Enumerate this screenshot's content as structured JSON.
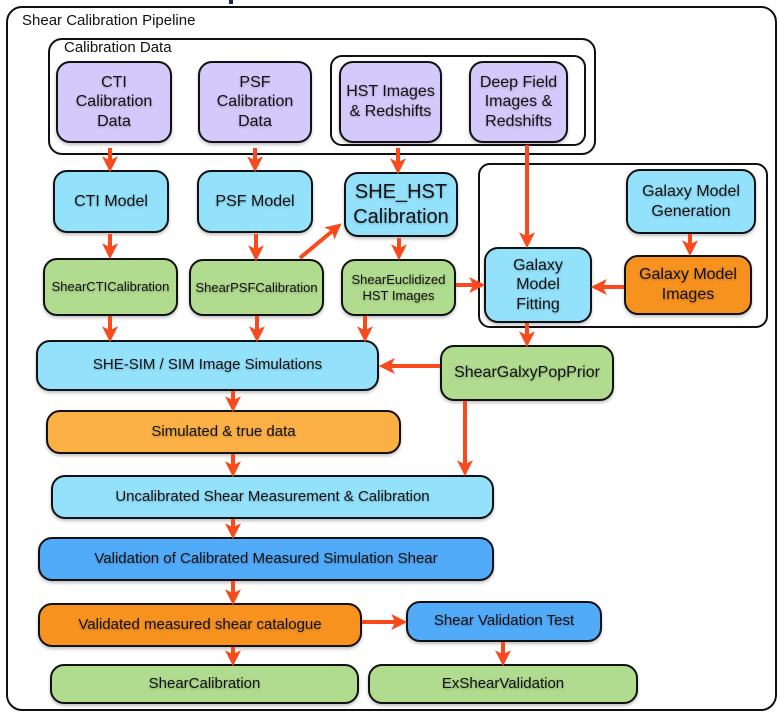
{
  "diagram": {
    "title": "Shear Calibration Pipeline",
    "colors": {
      "arrow": "#f84a1c",
      "input_data": "#d3c9fb",
      "process": "#93e1fb",
      "product": "#b1db8e",
      "data_light_orange": "#fbb045",
      "data_dark_orange": "#f7921f",
      "validation": "#52abf9",
      "border": "#111111"
    },
    "groups": {
      "calibration_data": {
        "label": "Calibration Data"
      }
    },
    "nodes": {
      "cti_calibration_data": "CTI\nCalibration\nData",
      "psf_calibration_data": "PSF\nCalibration\nData",
      "hst_images_redshifts": "HST Images\n& Redshifts",
      "deep_field_images_redshifts": "Deep Field\nImages &\nRedshifts",
      "cti_model": "CTI Model",
      "psf_model": "PSF Model",
      "she_hst_calibration": "SHE_HST\nCalibration",
      "galaxy_model_generation": "Galaxy Model\nGeneration",
      "shear_cti_calibration": "ShearCTICalibration",
      "shear_psf_calibration": "ShearPSFCalibration",
      "shear_euclidized_hst_images": "ShearEuclidized\nHST Images",
      "galaxy_model_fitting": "Galaxy\nModel\nFitting",
      "galaxy_model_images": "Galaxy Model\nImages",
      "she_sim_image_simulations": "SHE-SIM / SIM Image Simulations",
      "shear_galaxy_pop_prior": "ShearGalxyPopPrior",
      "simulated_true_data": "Simulated & true data",
      "uncalibrated_shear_measurement": "Uncalibrated Shear Measurement & Calibration",
      "validation_calibrated_measured": "Validation of Calibrated Measured Simulation Shear",
      "validated_measured_shear_catalogue": "Validated measured shear catalogue",
      "shear_validation_test": "Shear Validation Test",
      "shear_calibration": "ShearCalibration",
      "ex_shear_validation": "ExShearValidation"
    },
    "edges": [
      [
        "cti_calibration_data",
        "cti_model"
      ],
      [
        "psf_calibration_data",
        "psf_model"
      ],
      [
        "hst_images_redshifts",
        "she_hst_calibration"
      ],
      [
        "deep_field_images_redshifts",
        "galaxy_model_fitting"
      ],
      [
        "cti_model",
        "shear_cti_calibration"
      ],
      [
        "psf_model",
        "shear_psf_calibration"
      ],
      [
        "shear_psf_calibration",
        "she_hst_calibration"
      ],
      [
        "she_hst_calibration",
        "shear_euclidized_hst_images"
      ],
      [
        "shear_euclidized_hst_images",
        "galaxy_model_fitting"
      ],
      [
        "galaxy_model_generation",
        "galaxy_model_images"
      ],
      [
        "galaxy_model_images",
        "galaxy_model_fitting"
      ],
      [
        "galaxy_model_fitting",
        "shear_galaxy_pop_prior"
      ],
      [
        "shear_cti_calibration",
        "she_sim_image_simulations"
      ],
      [
        "shear_psf_calibration",
        "she_sim_image_simulations"
      ],
      [
        "shear_euclidized_hst_images",
        "she_sim_image_simulations"
      ],
      [
        "shear_galaxy_pop_prior",
        "she_sim_image_simulations"
      ],
      [
        "she_sim_image_simulations",
        "simulated_true_data"
      ],
      [
        "shear_galaxy_pop_prior",
        "uncalibrated_shear_measurement"
      ],
      [
        "simulated_true_data",
        "uncalibrated_shear_measurement"
      ],
      [
        "uncalibrated_shear_measurement",
        "validation_calibrated_measured"
      ],
      [
        "validation_calibrated_measured",
        "validated_measured_shear_catalogue"
      ],
      [
        "validated_measured_shear_catalogue",
        "shear_validation_test"
      ],
      [
        "validated_measured_shear_catalogue",
        "shear_calibration"
      ],
      [
        "shear_validation_test",
        "ex_shear_validation"
      ]
    ]
  }
}
